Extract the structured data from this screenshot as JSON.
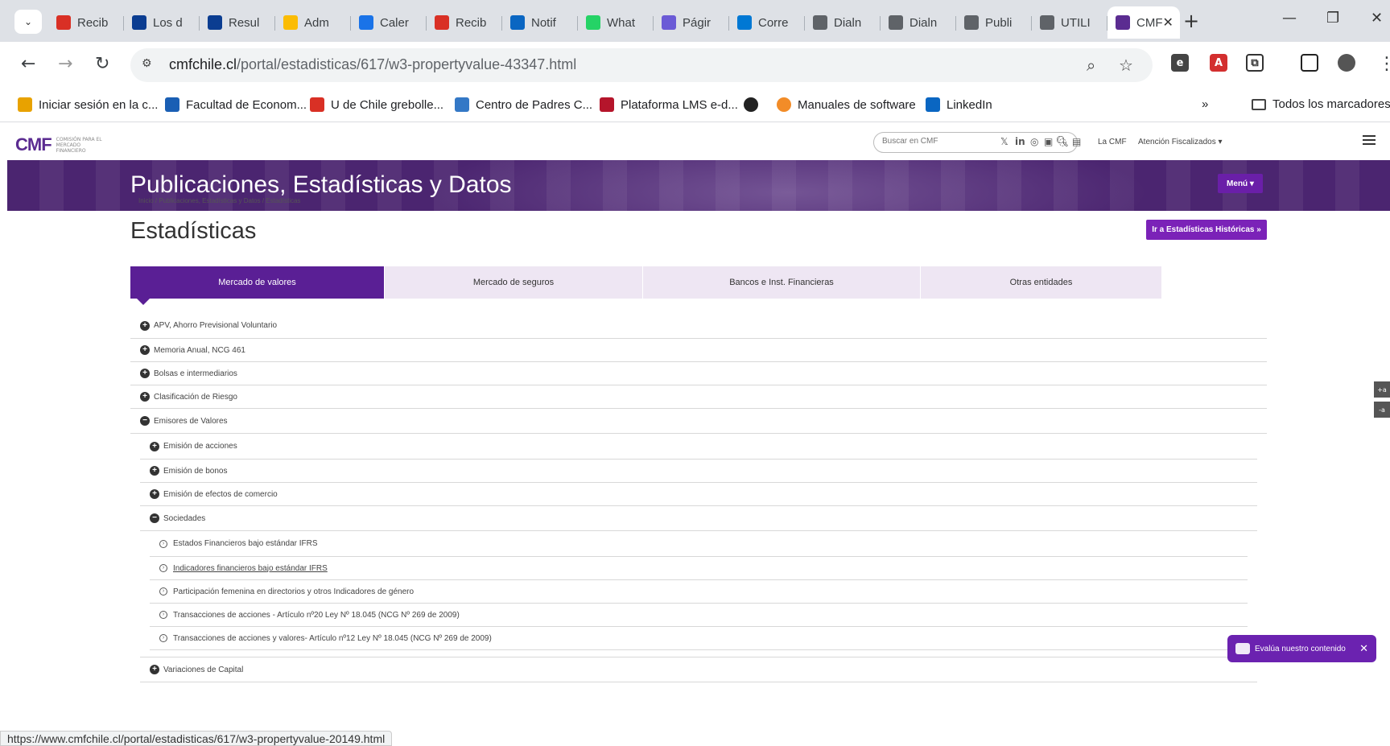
{
  "browser": {
    "tabs": [
      {
        "label": "Recib",
        "icon": "gmail-icon",
        "color": "#d93025"
      },
      {
        "label": "Los d",
        "icon": "america-retail-icon",
        "color": "#0b3d91"
      },
      {
        "label": "Resul",
        "icon": "america-retail-icon",
        "color": "#0b3d91"
      },
      {
        "label": "Adm",
        "icon": "google-ads-icon",
        "color": "#fbbc04"
      },
      {
        "label": "Caler",
        "icon": "calendar-icon",
        "color": "#1a73e8"
      },
      {
        "label": "Recib",
        "icon": "gmail-icon",
        "color": "#d93025"
      },
      {
        "label": "Notif",
        "icon": "linkedin-icon",
        "color": "#0a66c2"
      },
      {
        "label": "What",
        "icon": "whatsapp-icon",
        "color": "#25d366"
      },
      {
        "label": "Págir",
        "icon": "copilot-icon",
        "color": "#6b5bd6"
      },
      {
        "label": "Corre",
        "icon": "outlook-icon",
        "color": "#0078d4"
      },
      {
        "label": "Dialn",
        "icon": "globe-icon",
        "color": "#5f6368"
      },
      {
        "label": "Dialn",
        "icon": "globe-icon",
        "color": "#5f6368"
      },
      {
        "label": "Publi",
        "icon": "globe-icon",
        "color": "#5f6368"
      },
      {
        "label": "UTILI",
        "icon": "globe-icon",
        "color": "#5f6368"
      },
      {
        "label": "CMF",
        "icon": "cmf-icon",
        "color": "#5b2c91"
      }
    ],
    "url_domain": "cmfchile.cl",
    "url_path": "/portal/estadisticas/617/w3-propertyvalue-43347.html",
    "bookmarks": [
      {
        "label": "Iniciar sesión en la c...",
        "icon": "uchile-icon",
        "color": "#e8a200"
      },
      {
        "label": "Facultad de Econom...",
        "icon": "fen-icon",
        "color": "#1a5fb4"
      },
      {
        "label": "U de Chile grebolle...",
        "icon": "gmail-icon",
        "color": "#d93025"
      },
      {
        "label": "Centro de Padres C...",
        "icon": "cp-icon",
        "color": "#3478c6"
      },
      {
        "label": "Plataforma LMS e-d...",
        "icon": "lms-icon",
        "color": "#b5152b"
      },
      {
        "label": "",
        "icon": "globe-icon",
        "color": "#222"
      },
      {
        "label": "Manuales de software",
        "icon": "circle-icon",
        "color": "#f28c28"
      },
      {
        "label": "LinkedIn",
        "icon": "linkedin-icon",
        "color": "#0a66c2"
      }
    ],
    "all_bookmarks": "Todos los marcadores",
    "status_url": "https://www.cmfchile.cl/portal/estadisticas/617/w3-propertyvalue-20149.html"
  },
  "header": {
    "logo": "CMF",
    "logo_sub": "COMISIÓN PARA EL MERCADO FINANCIERO",
    "search_placeholder": "Buscar en CMF",
    "la_cmf": "La CMF",
    "atencion": "Atención Fiscalizados ▾"
  },
  "banner": {
    "title": "Publicaciones, Estadísticas y Datos",
    "menu": "Menú ▾"
  },
  "breadcrumb": "Inicio / Publicaciones, Estadísticas y Datos / Estadísticas",
  "page_title": "Estadísticas",
  "hist_button": "Ir a Estadísticas Históricas »",
  "section_tabs": [
    "Mercado de valores",
    "Mercado de seguros",
    "Bancos e Inst. Financieras",
    "Otras entidades"
  ],
  "tree": {
    "level1": [
      "APV, Ahorro Previsional Voluntario",
      "Memoria Anual, NCG 461",
      "Bolsas e intermediarios",
      "Clasificación de Riesgo",
      "Emisores de Valores"
    ],
    "level2": [
      "Emisión de acciones",
      "Emisión de bonos",
      "Emisión de efectos de comercio",
      "Sociedades"
    ],
    "level3": [
      "Estados Financieros bajo estándar IFRS",
      "Indicadores financieros bajo estándar IFRS",
      "Participación femenina en directorios y otros Indicadores de género",
      "Transacciones de acciones - Artículo nº20 Ley Nº 18.045 (NCG Nº 269 de 2009)",
      "Transacciones de acciones y valores- Artículo nº12 Ley Nº 18.045 (NCG Nº 269 de 2009)"
    ],
    "partial": "Variaciones de Capital"
  },
  "font_controls": [
    "+a",
    "-a"
  ],
  "feedback": "Evalúa nuestro contenido"
}
